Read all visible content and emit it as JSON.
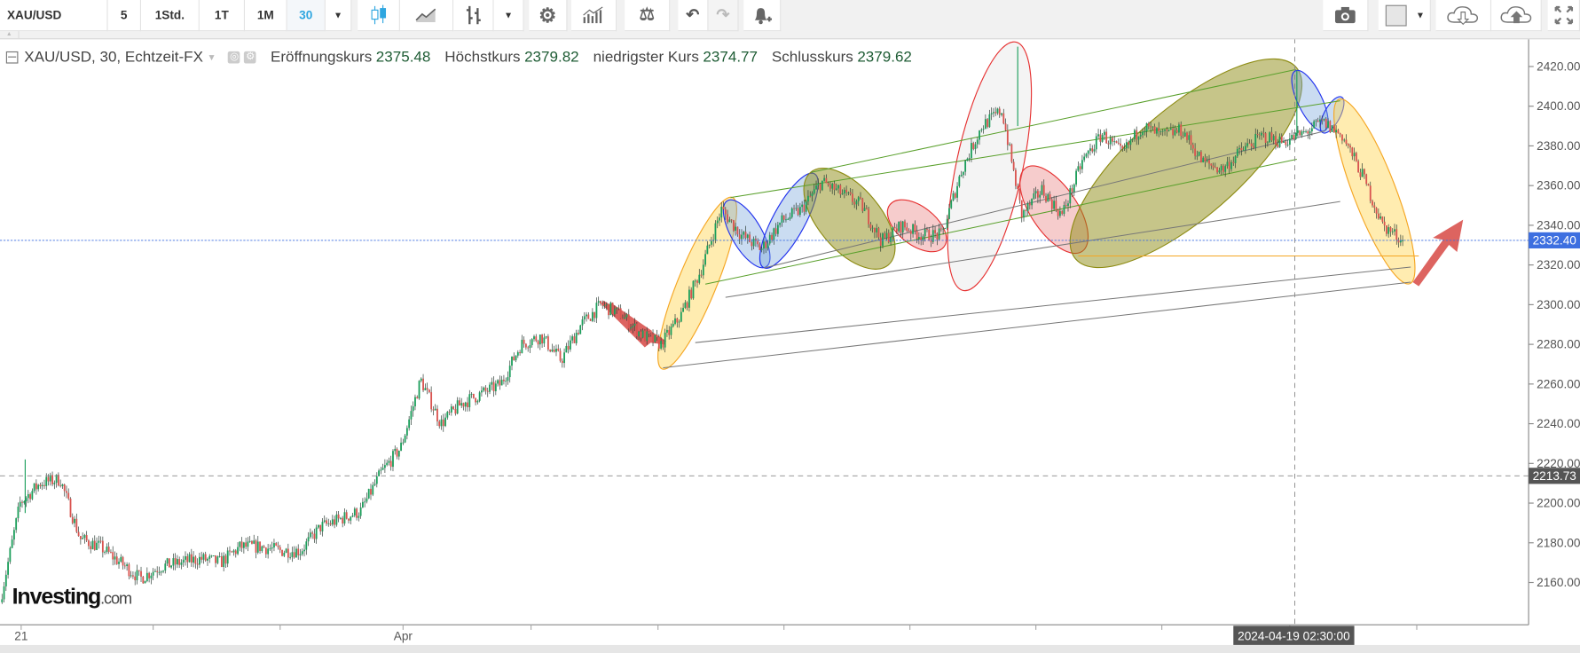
{
  "toolbar": {
    "symbol": "XAU/USD",
    "intervals": [
      "5",
      "1Std.",
      "1T",
      "1M",
      "30"
    ],
    "active_interval": "30",
    "accent": "#2ea6e0",
    "icons": [
      "candlestick-icon",
      "area-chart-icon",
      "bar-chart-icon",
      "gear-icon",
      "indicators-icon",
      "scale-icon",
      "undo-icon",
      "redo-icon",
      "alert-bell-icon",
      "camera-icon",
      "color-box-icon",
      "cloud-download-icon",
      "cloud-upload-icon",
      "fullscreen-icon"
    ]
  },
  "legend": {
    "title": "XAU/USD, 30, Echtzeit-FX",
    "open_label": "Eröffnungskurs",
    "open": "2375.48",
    "high_label": "Höchstkurs",
    "high": "2379.82",
    "low_label": "niedrigster Kurs",
    "low": "2374.77",
    "close_label": "Schlusskurs",
    "close": "2379.62"
  },
  "logo": {
    "text": "Investing",
    "suffix": ".com"
  },
  "chart_data": {
    "type": "candlestick",
    "symbol": "XAU/USD",
    "interval": "30",
    "ylim": [
      2140,
      2430
    ],
    "y_ticks": [
      "2420.00",
      "2400.00",
      "2380.00",
      "2360.00",
      "2340.00",
      "2320.00",
      "2300.00",
      "2280.00",
      "2260.00",
      "2240.00",
      "2220.00",
      "2200.00",
      "2180.00",
      "2160.00"
    ],
    "x_tick_labels": [
      "21",
      "Apr"
    ],
    "crosshair_time": "2024-04-19 02:30:00",
    "last_price": "2332.40",
    "last_price_color": "#3d6fe0",
    "crosshair_price": "2213.73",
    "up_color": "#1c9e5b",
    "down_color": "#d9534f",
    "approx_closes": [
      2150,
      2200,
      2210,
      2212,
      2182,
      2178,
      2170,
      2162,
      2168,
      2170,
      2172,
      2170,
      2178,
      2178,
      2176,
      2176,
      2188,
      2192,
      2196,
      2215,
      2228,
      2262,
      2240,
      2250,
      2255,
      2260,
      2280,
      2284,
      2272,
      2290,
      2300,
      2295,
      2285,
      2280,
      2295,
      2318,
      2348,
      2335,
      2328,
      2342,
      2348,
      2362,
      2356,
      2350,
      2332,
      2340,
      2335,
      2335,
      2368,
      2390,
      2398,
      2345,
      2358,
      2345,
      2372,
      2386,
      2376,
      2390,
      2385,
      2388,
      2372,
      2368,
      2378,
      2385,
      2382,
      2386,
      2392,
      2385,
      2365,
      2340,
      2332.4
    ]
  }
}
